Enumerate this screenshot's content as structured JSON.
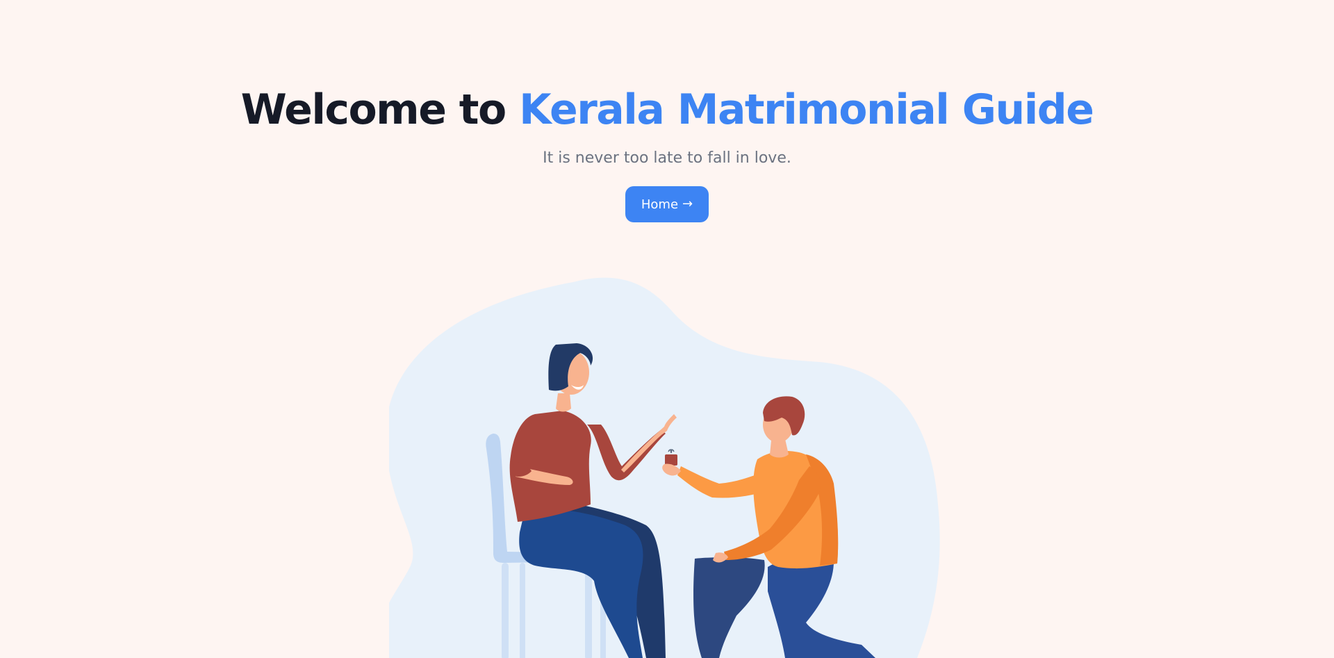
{
  "hero": {
    "title_prefix": "Welcome to",
    "title_accent": "Kerala Matrimonial Guide",
    "subtitle": "It is never too late to fall in love.",
    "home_button_label": "Home",
    "home_button_icon": "arrow-right-icon"
  },
  "colors": {
    "background": "#fef5f2",
    "title_dark": "#161a27",
    "accent": "#3d84f3",
    "subtitle": "#6b7280",
    "blob": "#e8f1fa"
  },
  "illustration": {
    "icon": "proposal-illustration"
  }
}
